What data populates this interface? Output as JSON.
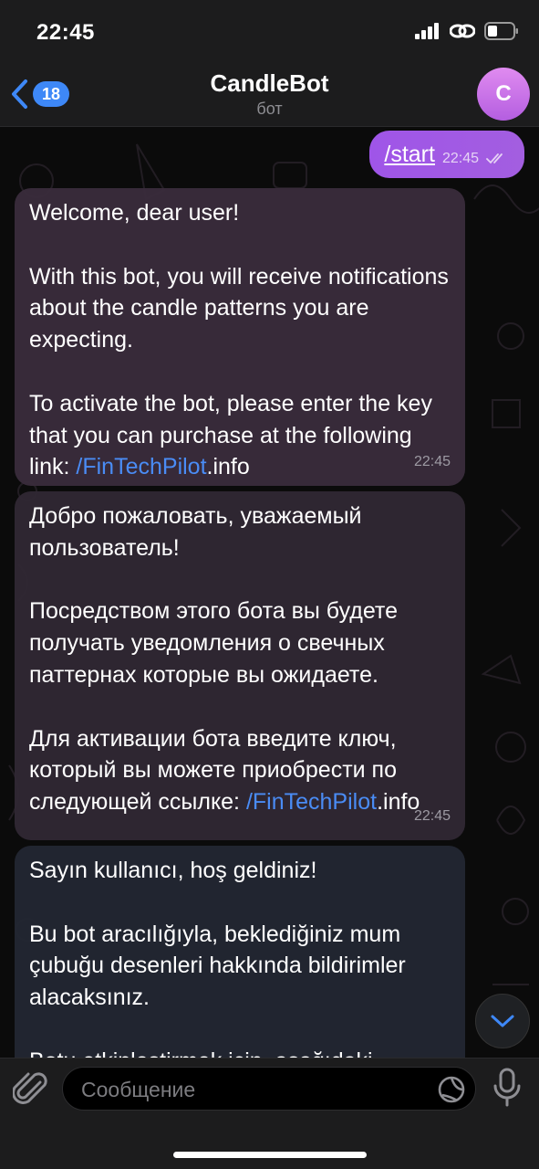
{
  "status_bar": {
    "time": "22:45"
  },
  "header": {
    "back_badge": "18",
    "title": "CandleBot",
    "subtitle": "бот",
    "avatar_letter": "C"
  },
  "messages": {
    "outgoing": {
      "text": "/start",
      "time": "22:45"
    },
    "english": {
      "p1": "Welcome, dear user!",
      "p2": "With this bot, you will receive notifications about the candle patterns you are expecting.",
      "p3_text": "To activate the bot, please enter the key that you can purchase at the following link: ",
      "link": "/FinTechPilot",
      "link_suffix": ".info",
      "time": "22:45"
    },
    "russian": {
      "p1": "Добро пожаловать, уважаемый пользователь!",
      "p2": "Посредством этого бота вы будете получать уведомления о свечных паттернах которые вы ожидаете.",
      "p3_text": "Для активации бота введите ключ, который вы можете приобрести по следующей ссылке: ",
      "link": "/FinTechPilot",
      "link_suffix": ".info",
      "time": "22:45"
    },
    "turkish": {
      "p1": "Sayın kullanıcı, hoş geldiniz!",
      "p2": "Bu bot aracılığıyla, beklediğiniz mum çubuğu desenleri hakkında bildirimler alacaksınız.",
      "p3_text": "Botu etkinleştirmek için, aşağıdaki"
    }
  },
  "input": {
    "placeholder": "Сообщение"
  },
  "colors": {
    "accent_blue": "#3e88f7",
    "link_blue": "#4a8cf5",
    "outgoing_bubble": "#a35ee0",
    "avatar": "#c77ae8"
  }
}
